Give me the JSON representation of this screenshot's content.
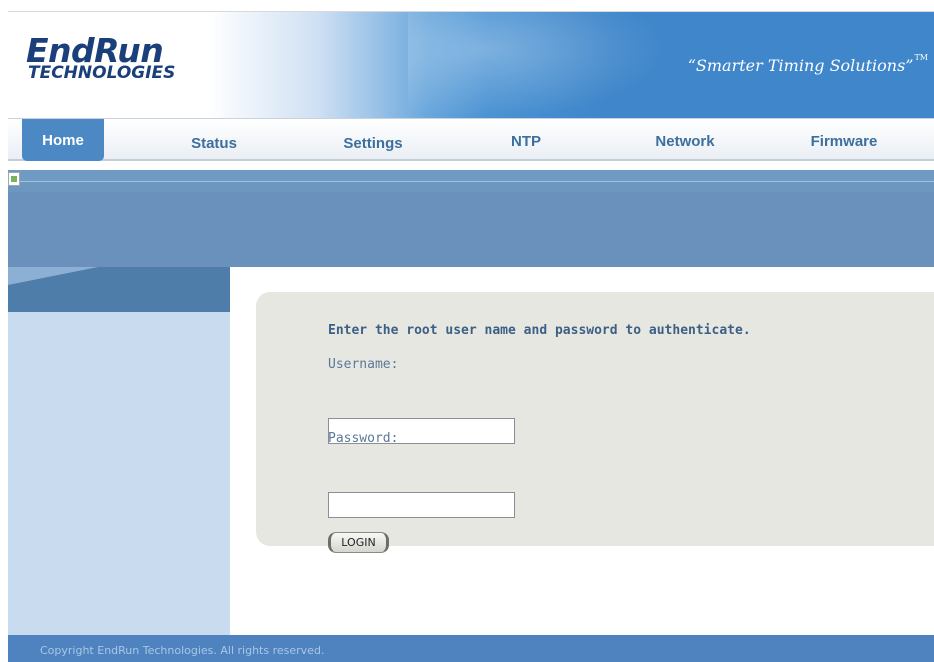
{
  "header": {
    "logo_line1": "EndRun",
    "logo_line2": "TECHNOLOGIES",
    "tagline": "“Smarter Timing Solutions”",
    "tagline_mark": "TM"
  },
  "nav": {
    "tabs": [
      {
        "label": "Home",
        "active": true
      },
      {
        "label": "Status",
        "active": false
      },
      {
        "label": "Settings",
        "active": false
      },
      {
        "label": "NTP",
        "active": false
      },
      {
        "label": "Network",
        "active": false
      },
      {
        "label": "Firmware",
        "active": false
      }
    ]
  },
  "login": {
    "heading": "Enter the root user name and password to authenticate.",
    "username_label": "Username:",
    "username_value": "",
    "password_label": "Password:",
    "password_value": "",
    "button_label": "LOGIN"
  },
  "footer": {
    "copyright": "Copyright EndRun Technologies. All rights reserved."
  },
  "colors": {
    "brand_blue": "#3f86ca",
    "nav_text": "#3d6f9e",
    "active_tab": "#4b88c4",
    "band": "#6991bb",
    "sidebar": "#c8dbef",
    "panel": "#e7e7e1",
    "footer": "#4f83c0"
  }
}
